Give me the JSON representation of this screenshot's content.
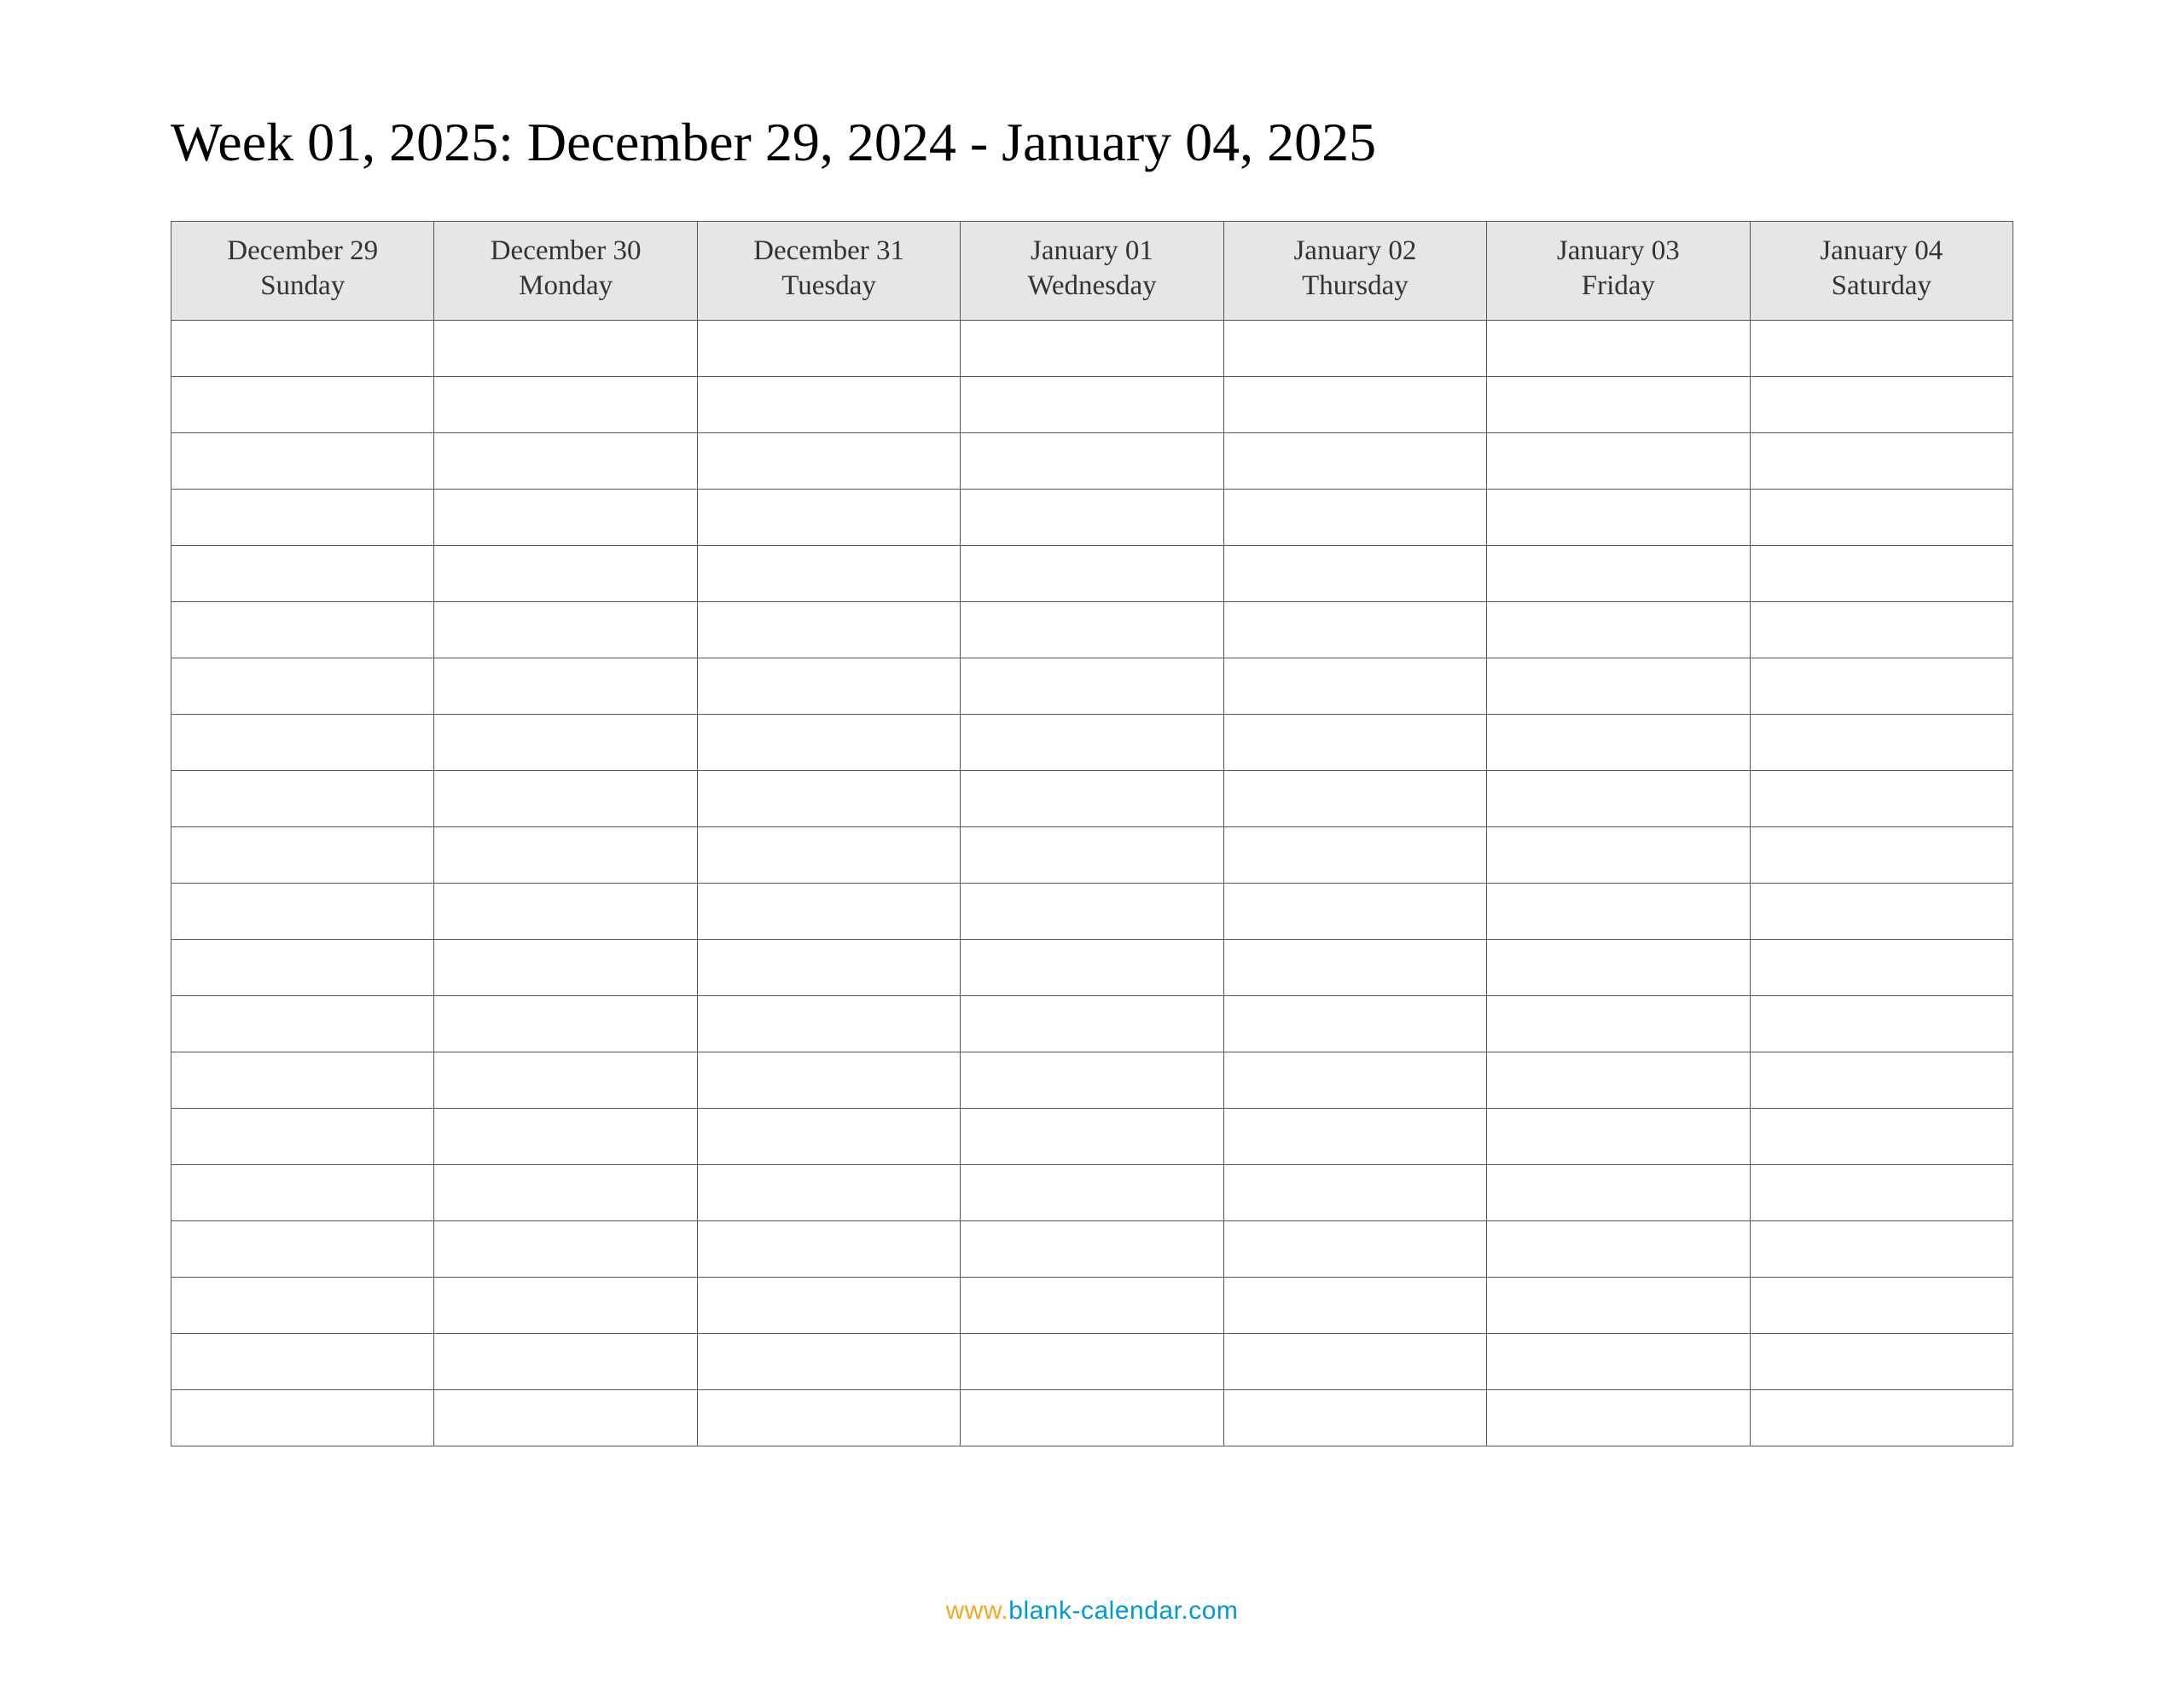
{
  "title": "Week 01, 2025: December 29, 2024 - January 04, 2025",
  "columns": [
    {
      "date": "December 29",
      "day": "Sunday"
    },
    {
      "date": "December 30",
      "day": "Monday"
    },
    {
      "date": "December 31",
      "day": "Tuesday"
    },
    {
      "date": "January 01",
      "day": "Wednesday"
    },
    {
      "date": "January 02",
      "day": "Thursday"
    },
    {
      "date": "January 03",
      "day": "Friday"
    },
    {
      "date": "January 04",
      "day": "Saturday"
    }
  ],
  "row_count": 20,
  "footer": {
    "www": "www.",
    "domain": "blank-calendar.com"
  }
}
